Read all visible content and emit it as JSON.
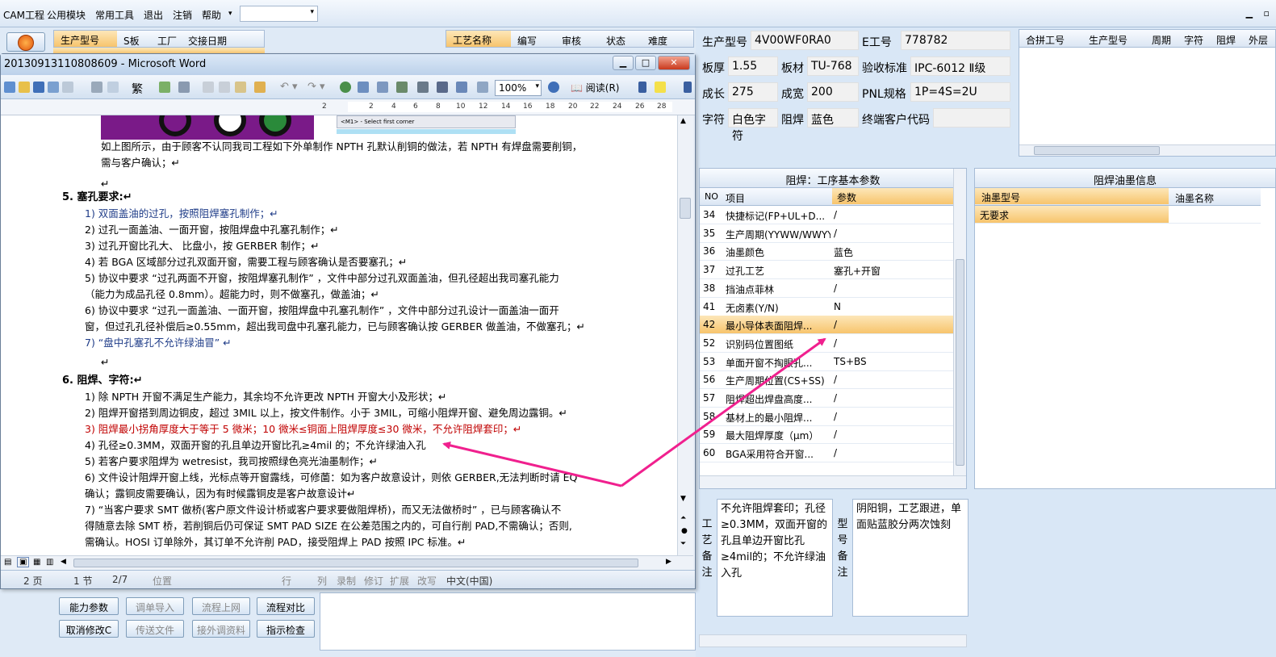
{
  "menu": {
    "items": [
      "CAM工程",
      "公用模块",
      "常用工具",
      "退出",
      "注销",
      "帮助"
    ],
    "combo_value": ""
  },
  "left_grid": {
    "headers": [
      "生产型号",
      "S板",
      "工厂",
      "交接日期"
    ]
  },
  "process_grid": {
    "headers": [
      "工艺名称",
      "编写",
      "审核",
      "状态",
      "难度"
    ]
  },
  "word": {
    "title": "20130913110808609 - Microsoft Word",
    "zoom": "100%",
    "read_label": "阅读(R)",
    "ruler_ticks": [
      "2",
      "2",
      "4",
      "6",
      "8",
      "10",
      "12",
      "14",
      "16",
      "18",
      "20",
      "22",
      "24",
      "26",
      "28"
    ],
    "status": {
      "page": "2 页",
      "section": "1 节",
      "pages": "2/7",
      "position": "位置",
      "row": "行",
      "col": "列",
      "rec": "录制",
      "rev": "修订",
      "ext": "扩展",
      "ovr": "改写",
      "lang": "中文(中国)"
    },
    "embedded_caption": "<M1> - Select first corner",
    "lines": [
      {
        "t": "如上图所示，由于顾客不认同我司工程如下外单制作 NPTH 孔默认削铜的做法，若 NPTH 有焊盘需要削铜，",
        "s": "n"
      },
      {
        "t": "需与客户确认；↵",
        "s": "n"
      },
      {
        "t": "↵",
        "s": "n"
      },
      {
        "t": "5.    塞孔要求:↵",
        "s": "h"
      },
      {
        "t": "1)   双面盖油的过孔，按照阻焊塞孔制作；↵",
        "s": "blue"
      },
      {
        "t": "2)   过孔一面盖油、一面开窗，按阻焊盘中孔塞孔制作；↵",
        "s": "n"
      },
      {
        "t": "3)   过孔开窗比孔大、 比盘小，按 GERBER 制作；↵",
        "s": "n"
      },
      {
        "t": "4)   若 BGA 区域部分过孔双面开窗，需要工程与顾客确认是否要塞孔；↵",
        "s": "n"
      },
      {
        "t": "5)   协议中要求 “过孔两面不开窗，按阻焊塞孔制作” ，文件中部分过孔双面盖油，但孔径超出我司塞孔能力",
        "s": "n"
      },
      {
        "t": "      （能力为成品孔径 0.8mm）。超能力时，则不做塞孔，做盖油；↵",
        "s": "n"
      },
      {
        "t": "6)   协议中要求 “过孔一面盖油、一面开窗，按阻焊盘中孔塞孔制作” ，文件中部分过孔设计一面盖油一面开",
        "s": "n"
      },
      {
        "t": "      窗，但过孔孔径补偿后≥0.55mm，超出我司盘中孔塞孔能力，已与顾客确认按 GERBER 做盖油，不做塞孔；↵",
        "s": "n"
      },
      {
        "t": "7)   “盘中孔塞孔不允许绿油冒” ↵",
        "s": "blue"
      },
      {
        "t": "↵",
        "s": "n"
      },
      {
        "t": "6.    阻焊、字符:↵",
        "s": "h"
      },
      {
        "t": "1)   除 NPTH 开窗不满足生产能力，其余均不允许更改 NPTH 开窗大小及形状；↵",
        "s": "n"
      },
      {
        "t": "2)   阻焊开窗搭到周边铜皮，超过 3MIL 以上，按文件制作。小于 3MIL，可缩小阻焊开窗、避免周边露铜。↵",
        "s": "n"
      },
      {
        "t": "3)   阻焊最小拐角厚度大于等于 5 微米；10 微米≤铜面上阻焊厚度≤30 微米，不允许阻焊套印；↵",
        "s": "red"
      },
      {
        "t": "4)   孔径≥0.3MM，双面开窗的孔且单边开窗比孔≥4mil 的；不允许绿油入孔",
        "s": "n"
      },
      {
        "t": "5)   若客户要求阻焊为 wetresist，我司按照绿色亮光油墨制作；↵",
        "s": "n"
      },
      {
        "t": "6)   文件设计阻焊开窗上线，光标点等开窗露线，可修薗：如为客户故意设计，则依 GERBER,无法判断时请 EQ",
        "s": "n"
      },
      {
        "t": "      确认；露铜皮需要确认，因为有时候露铜皮是客户故意设计↵",
        "s": "n"
      },
      {
        "t": "7)   “当客户要求 SMT 做桥(客户原文件设计桥或客户要求要做阻焊桥)，而又无法做桥时” ，已与顾客确认不",
        "s": "n"
      },
      {
        "t": "      得随意去除 SMT 桥，若削铜后仍可保证 SMT PAD SIZE 在公差范围之内的，可自行削 PAD,不需确认；否则,",
        "s": "n"
      },
      {
        "t": "      需确认。HOSI 订单除外，其订单不允许削 PAD，接受阻焊上 PAD 按照 IPC 标准。↵",
        "s": "n"
      }
    ]
  },
  "bottom_buttons": [
    {
      "label": "能力参数",
      "enabled": true
    },
    {
      "label": "调单导入",
      "enabled": false
    },
    {
      "label": "流程上网",
      "enabled": false
    },
    {
      "label": "流程对比",
      "enabled": true
    },
    {
      "label": "取消修改C",
      "enabled": true
    },
    {
      "label": "传送文件",
      "enabled": false
    },
    {
      "label": "接外调资料",
      "enabled": false
    },
    {
      "label": "指示检查",
      "enabled": true
    }
  ],
  "info": {
    "model_label": "生产型号",
    "model": "4V00WF0RA0",
    "e_label": "E工号",
    "e_no": "778782",
    "thickness_label": "板厚",
    "thickness": "1.55",
    "material_label": "板材",
    "material": "TU-768",
    "standard_label": "验收标准",
    "standard": "IPC-6012 Ⅱ级",
    "length_label": "成长",
    "length": "275",
    "width_label": "成宽",
    "width": "200",
    "pnl_label": "PNL规格",
    "pnl": "1P=4S=2U",
    "char_label": "字符",
    "char": "白色字符",
    "mask_label": "阻焊",
    "mask": "蓝色",
    "customer_label": "终端客户代码",
    "customer": ""
  },
  "merge_grid": {
    "headers": [
      "合拼工号",
      "生产型号",
      "周期",
      "字符",
      "阻焊",
      "外层"
    ]
  },
  "params_panel": {
    "title": "阻焊：工序基本参数",
    "col_no": "NO",
    "col_item": "项目",
    "col_param": "参数",
    "rows": [
      {
        "no": "34",
        "item": "快捷标记(FP+UL+D...",
        "param": "/"
      },
      {
        "no": "35",
        "item": "生产周期(YYWW/WWYY)",
        "param": "/"
      },
      {
        "no": "36",
        "item": "油墨颜色",
        "param": "蓝色"
      },
      {
        "no": "37",
        "item": "过孔工艺",
        "param": "塞孔+开窗"
      },
      {
        "no": "38",
        "item": "挡油点菲林",
        "param": "/"
      },
      {
        "no": "41",
        "item": "无卤素(Y/N)",
        "param": "N"
      },
      {
        "no": "42",
        "item": "最小导体表面阻焊...",
        "param": "/"
      },
      {
        "no": "52",
        "item": "识别码位置图纸",
        "param": "/"
      },
      {
        "no": "53",
        "item": "单面开窗不掏眼孔...",
        "param": "TS+BS"
      },
      {
        "no": "56",
        "item": "生产周期位置(CS+SS)",
        "param": "/"
      },
      {
        "no": "57",
        "item": "阻焊超出焊盘高度...",
        "param": "/"
      },
      {
        "no": "58",
        "item": "基材上的最小阻焊...",
        "param": "/"
      },
      {
        "no": "59",
        "item": "最大阻焊厚度（μm）",
        "param": "/"
      },
      {
        "no": "60",
        "item": "BGA采用符合开窗...",
        "param": "/"
      }
    ]
  },
  "ink_panel": {
    "title": "阻焊油墨信息",
    "col_model": "油墨型号",
    "col_name": "油墨名称",
    "row_model": "无要求",
    "row_name": ""
  },
  "notes": {
    "craft_label": [
      "工",
      "艺",
      "备",
      "注"
    ],
    "craft_text": "不允许阻焊套印；孔径≥0.3MM，双面开窗的孔且单边开窗比孔≥4mil的；不允许绿油入孔",
    "model_label": [
      "型",
      "号",
      "备",
      "注"
    ],
    "model_text": "阴阳铜，工艺跟进，单面贴蓝胶分两次蚀刻"
  },
  "annotation_color": "#f0208e"
}
